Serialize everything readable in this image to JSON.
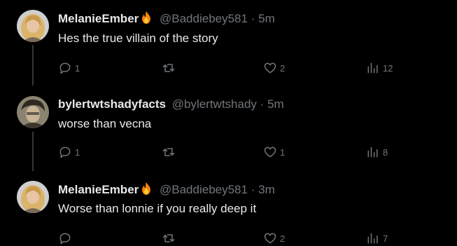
{
  "tweets": [
    {
      "name": "MelanieEmber",
      "handle": "@Baddiebey581",
      "sep": "·",
      "time": "5m",
      "text": "Hes the true villain of the story",
      "replies": "1",
      "retweets": "",
      "likes": "2",
      "views": "12",
      "avatar": "blonde-woman-avatar",
      "emoji": "fire-emoji"
    },
    {
      "name": "bylertwtshadyfacts",
      "handle": "@bylertwtshady",
      "sep": "·",
      "time": "5m",
      "text": "worse than vecna",
      "replies": "1",
      "retweets": "",
      "likes": "1",
      "views": "8",
      "avatar": "character-avatar"
    },
    {
      "name": "MelanieEmber",
      "handle": "@Baddiebey581",
      "sep": "·",
      "time": "3m",
      "text": "Worse than lonnie if you really deep it",
      "replies": "",
      "retweets": "",
      "likes": "2",
      "views": "7",
      "avatar": "blonde-woman-avatar",
      "emoji": "fire-emoji"
    }
  ],
  "colors": {
    "background": "#000000",
    "text": "#e7e9ea",
    "muted": "#71767b",
    "thread_line": "#333639"
  }
}
